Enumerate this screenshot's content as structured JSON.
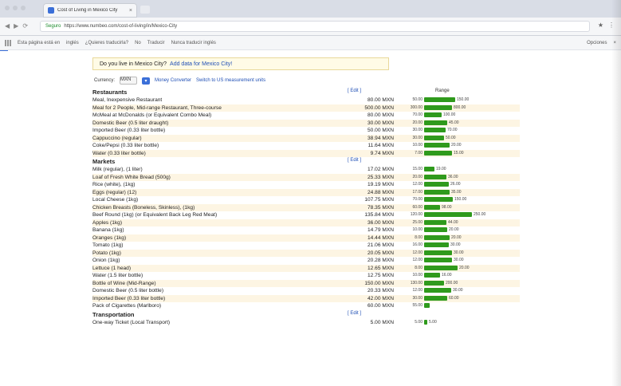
{
  "browser": {
    "tab_title": "Cost of Living in Mexico City",
    "tab_close": "×",
    "url_secure": "Seguro",
    "url": "https://www.numbeo.com/cost-of-living/in/Mexico-City",
    "nav": [
      "◀",
      "▶",
      "⟳"
    ],
    "toolbar_icons": [
      "★",
      "⋮"
    ],
    "bookmarks": {
      "label": "Esta página está en",
      "lang_from": "inglés",
      "prompt": "¿Quieres traducirla?",
      "no": "No",
      "translate": "Traducir",
      "never": "Nunca traducir inglés",
      "options": "Opciones",
      "close": "×"
    }
  },
  "banner": {
    "question": "Do you live in Mexico City?",
    "link": "Add data for Mexico City!"
  },
  "currency": {
    "label": "Currency:",
    "value": "MXN",
    "button": "▾",
    "money_converter": "Money Converter",
    "switch_units": "Switch to US measurement units"
  },
  "table": {
    "edit_label": "[ Edit ]",
    "range_label": "Range",
    "sections": [
      {
        "title": "Restaurants",
        "rows": [
          {
            "name": "Meal, Inexpensive Restaurant",
            "price": "80.00 MXN",
            "min": "50.00",
            "max": "150.00",
            "bar": 0.55
          },
          {
            "name": "Meal for 2 People, Mid-range Restaurant, Three-course",
            "price": "500.00 MXN",
            "min": "300.00",
            "max": "800.00",
            "bar": 0.5
          },
          {
            "name": "McMeal at McDonalds (or Equivalent Combo Meal)",
            "price": "80.00 MXN",
            "min": "70.00",
            "max": "100.00",
            "bar": 0.32
          },
          {
            "name": "Domestic Beer (0.5 liter draught)",
            "price": "30.00 MXN",
            "min": "20.00",
            "max": "45.00",
            "bar": 0.42
          },
          {
            "name": "Imported Beer (0.33 liter bottle)",
            "price": "50.00 MXN",
            "min": "30.00",
            "max": "70.00",
            "bar": 0.38
          },
          {
            "name": "Cappuccino (regular)",
            "price": "38.94 MXN",
            "min": "30.00",
            "max": "50.00",
            "bar": 0.36
          },
          {
            "name": "Coke/Pepsi (0.33 liter bottle)",
            "price": "11.64 MXN",
            "min": "10.00",
            "max": "20.00",
            "bar": 0.45
          },
          {
            "name": "Water (0.33 liter bottle)",
            "price": "9.74 MXN",
            "min": "7.00",
            "max": "15.00",
            "bar": 0.5
          }
        ]
      },
      {
        "title": "Markets",
        "rows": [
          {
            "name": "Milk (regular), (1 liter)",
            "price": "17.02 MXN",
            "min": "15.00",
            "max": "19.00",
            "bar": 0.18
          },
          {
            "name": "Loaf of Fresh White Bread (500g)",
            "price": "25.33 MXN",
            "min": "20.00",
            "max": "36.00",
            "bar": 0.4
          },
          {
            "name": "Rice (white), (1kg)",
            "price": "19.19 MXN",
            "min": "12.00",
            "max": "26.00",
            "bar": 0.44
          },
          {
            "name": "Eggs (regular) (12)",
            "price": "24.88 MXN",
            "min": "17.00",
            "max": "35.00",
            "bar": 0.46
          },
          {
            "name": "Local Cheese (1kg)",
            "price": "107.75 MXN",
            "min": "70.00",
            "max": "150.00",
            "bar": 0.52
          },
          {
            "name": "Chicken Breasts (Boneless, Skinless), (1kg)",
            "price": "78.35 MXN",
            "min": "60.00",
            "max": "98.00",
            "bar": 0.28
          },
          {
            "name": "Beef Round (1kg) (or Equivalent Back Leg Red Meat)",
            "price": "135.84 MXN",
            "min": "120.00",
            "max": "250.00",
            "bar": 0.85
          },
          {
            "name": "Apples (1kg)",
            "price": "36.00 MXN",
            "min": "25.00",
            "max": "44.00",
            "bar": 0.4
          },
          {
            "name": "Banana (1kg)",
            "price": "14.79 MXN",
            "min": "10.00",
            "max": "20.00",
            "bar": 0.42
          },
          {
            "name": "Oranges (1kg)",
            "price": "14.44 MXN",
            "min": "8.00",
            "max": "20.00",
            "bar": 0.45
          },
          {
            "name": "Tomato (1kg)",
            "price": "21.06 MXN",
            "min": "16.00",
            "max": "30.00",
            "bar": 0.44
          },
          {
            "name": "Potato (1kg)",
            "price": "20.05 MXN",
            "min": "12.00",
            "max": "30.00",
            "bar": 0.5
          },
          {
            "name": "Onion (1kg)",
            "price": "20.28 MXN",
            "min": "12.00",
            "max": "30.00",
            "bar": 0.5
          },
          {
            "name": "Lettuce (1 head)",
            "price": "12.65 MXN",
            "min": "8.00",
            "max": "20.00",
            "bar": 0.6
          },
          {
            "name": "Water (1.5 liter bottle)",
            "price": "12.75 MXN",
            "min": "10.00",
            "max": "16.00",
            "bar": 0.28
          },
          {
            "name": "Bottle of Wine (Mid-Range)",
            "price": "150.00 MXN",
            "min": "130.00",
            "max": "200.00",
            "bar": 0.35
          },
          {
            "name": "Domestic Beer (0.5 liter bottle)",
            "price": "20.33 MXN",
            "min": "12.00",
            "max": "30.00",
            "bar": 0.48
          },
          {
            "name": "Imported Beer (0.33 liter bottle)",
            "price": "42.00 MXN",
            "min": "30.00",
            "max": "60.00",
            "bar": 0.42
          },
          {
            "name": "Pack of Cigarettes (Marlboro)",
            "price": "60.00 MXN",
            "min": "55.00",
            "max": "",
            "bar": 0.1
          }
        ]
      },
      {
        "title": "Transportation",
        "rows": [
          {
            "name": "One-way Ticket (Local Transport)",
            "price": "5.00 MXN",
            "min": "5.00",
            "max": "5.00",
            "bar": 0.06
          }
        ]
      }
    ]
  },
  "colors": {
    "accent": "#1f4fb5",
    "bar_green": "#2f9a1c",
    "row_highlight": "#fdf5e3",
    "banner_bg": "#fffbe6"
  }
}
